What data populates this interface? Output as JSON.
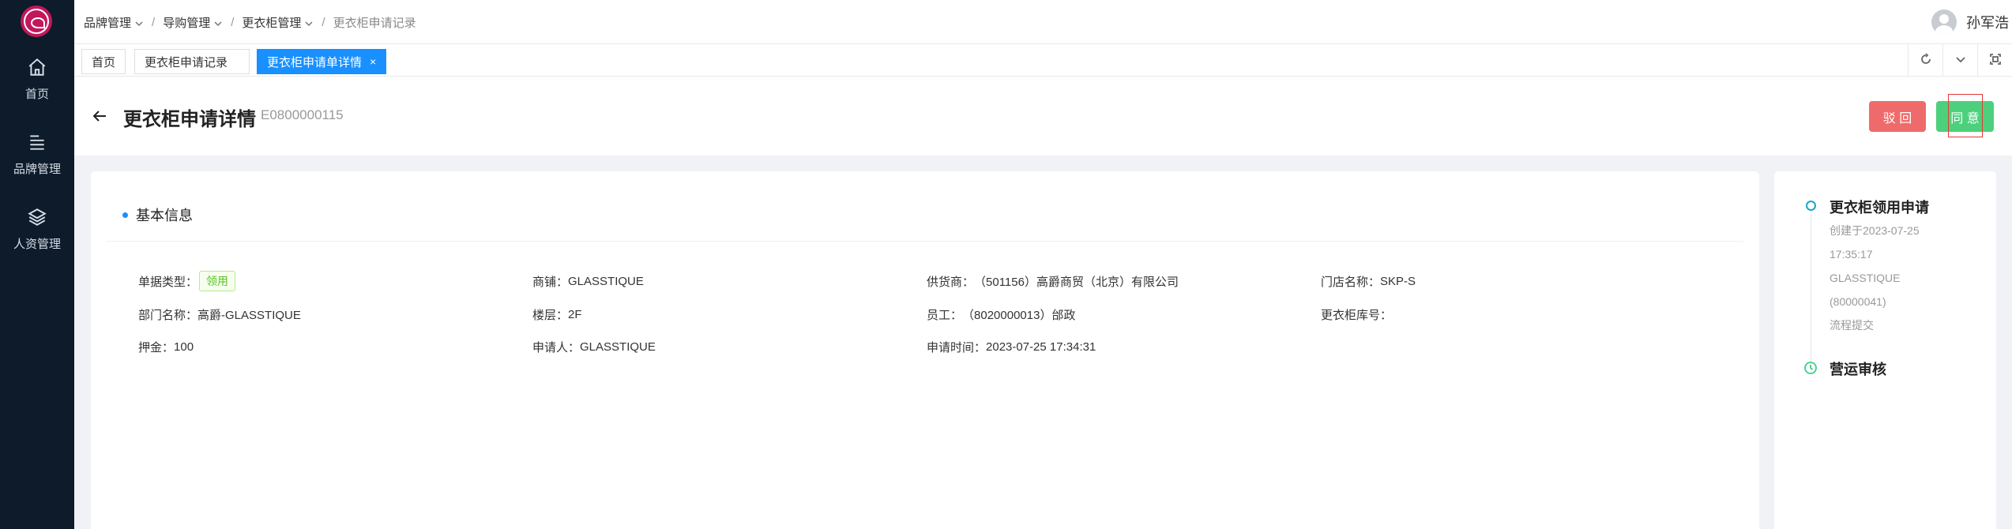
{
  "sidebar": {
    "items": [
      {
        "label": "首页",
        "icon": "home-icon"
      },
      {
        "label": "品牌管理",
        "icon": "list-icon"
      },
      {
        "label": "人资管理",
        "icon": "layers-icon"
      }
    ]
  },
  "breadcrumb": {
    "items": [
      "品牌管理",
      "导购管理",
      "更衣柜管理",
      "更衣柜申请记录"
    ]
  },
  "user": {
    "name": "孙军浩"
  },
  "tabs": [
    {
      "label": "首页"
    },
    {
      "label": "更衣柜申请记录"
    },
    {
      "label": "更衣柜申请单详情",
      "close": "×"
    }
  ],
  "page": {
    "title": "更衣柜申请详情",
    "code": "E0800000115",
    "reject_label": "驳 回",
    "agree_label": "同 意"
  },
  "basic_info": {
    "section_title": "基本信息",
    "fields": [
      {
        "label": "单据类型：",
        "value": "领用"
      },
      {
        "label": "商铺：",
        "value": "GLASSTIQUE"
      },
      {
        "label": "供货商：",
        "value": "（501156）高爵商贸（北京）有限公司"
      },
      {
        "label": "门店名称：",
        "value": "SKP-S"
      },
      {
        "label": "部门名称：",
        "value": "高爵-GLASSTIQUE"
      },
      {
        "label": "楼层：",
        "value": "2F"
      },
      {
        "label": "员工：",
        "value": "（8020000013）邰政"
      },
      {
        "label": "更衣柜库号：",
        "value": ""
      },
      {
        "label": "押金：",
        "value": "100"
      },
      {
        "label": "申请人：",
        "value": "GLASSTIQUE"
      },
      {
        "label": "申请时间：",
        "value": "2023-07-25 17:34:31"
      }
    ]
  },
  "flow": {
    "steps": [
      {
        "title": "更衣柜领用申请",
        "meta": [
          "创建于2023-07-25",
          "17:35:17",
          "GLASSTIQUE",
          "(80000041)",
          "流程提交"
        ]
      },
      {
        "title": "营运审核",
        "meta": []
      }
    ]
  },
  "colors": {
    "sidebar_bg": "#0d1b2a",
    "primary": "#1890ff",
    "reject": "#ef6b6b",
    "agree": "#4cd07c",
    "tag_green": "#52c41a"
  }
}
